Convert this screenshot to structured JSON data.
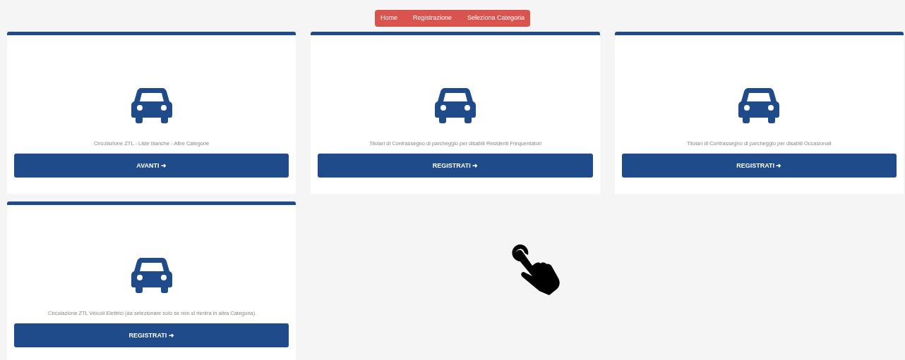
{
  "breadcrumb": [
    {
      "label": "Home"
    },
    {
      "label": "Registrazione"
    },
    {
      "label": "Seleziona Categoria"
    }
  ],
  "cards": [
    {
      "description": "Circolazione ZTL - Liste bianche - Altre Categorie",
      "button": "AVANTI ➜"
    },
    {
      "description": "Titolari di Contrassegno di parcheggio per disabili Residenti Frequentatori",
      "button": "REGISTRATI ➜"
    },
    {
      "description": "Titolari di Contrassegno di parcheggio per disabili Occasionali",
      "button": "REGISTRATI ➜"
    },
    {
      "description": "Circolazione ZTL Veicoli Elettrici (da selezionare solo se non si rientra in altra Categoria)",
      "button": "REGISTRATI ➜"
    }
  ]
}
